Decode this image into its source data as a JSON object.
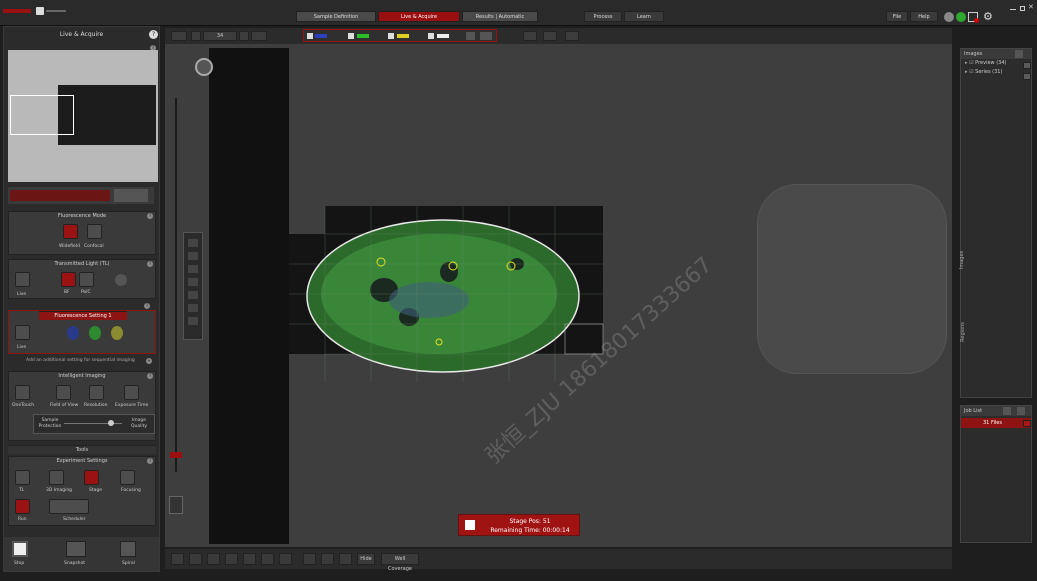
{
  "header": {
    "steps": [
      "Sample Definition",
      "Live & Acquire",
      "Results | Automatic"
    ],
    "buttons": [
      "Process",
      "Learn"
    ],
    "file_label": "File",
    "help_label": "Help"
  },
  "left": {
    "title": "Live & Acquire",
    "fluor_mode": {
      "title": "Fluorescence Mode",
      "widefield": "Widefield",
      "confocal": "Confocal"
    },
    "transmitted": {
      "title": "Transmitted Light (TL)",
      "live": "Live",
      "bf": "BF",
      "pol": "PolC"
    },
    "fluor_setting": {
      "title": "Fluorescence Setting 1",
      "live": "Live",
      "add_text": "Add an additional setting for sequential imaging"
    },
    "intelligent": {
      "title": "Intelligent Imaging",
      "items": [
        "OneTouch",
        "Field of View",
        "Resolution",
        "Exposure Time"
      ],
      "slider_left": "Sample Protection",
      "slider_right": "Image Quality"
    },
    "tools_title": "Tools",
    "experiment": {
      "title": "Experiment Settings",
      "items": [
        "TL",
        "3D Imaging",
        "Stage",
        "Focusing"
      ],
      "row2": [
        "Run",
        "Scheduler"
      ]
    },
    "bottom": [
      "Stop",
      "Snapshot",
      "Spiral"
    ]
  },
  "toolbar": {
    "zoom_value": "34"
  },
  "right": {
    "images_title": "Images",
    "items": [
      "Preview (34)",
      "Series (31)"
    ],
    "regions_title": "Regions",
    "images_tab": "Images",
    "job_title": "Job List",
    "job_item": "31 Files"
  },
  "bottom": {
    "hide": "Hide",
    "well_coverage": "Well Coverage"
  },
  "status": {
    "line1": "Stage Pos: 51",
    "line2": "Remaining Time: 00:00:14"
  },
  "watermark": "张恒_ZJU 18618017333667",
  "colors": {
    "accent": "#9a1010",
    "bg": "#3e3e3e"
  }
}
